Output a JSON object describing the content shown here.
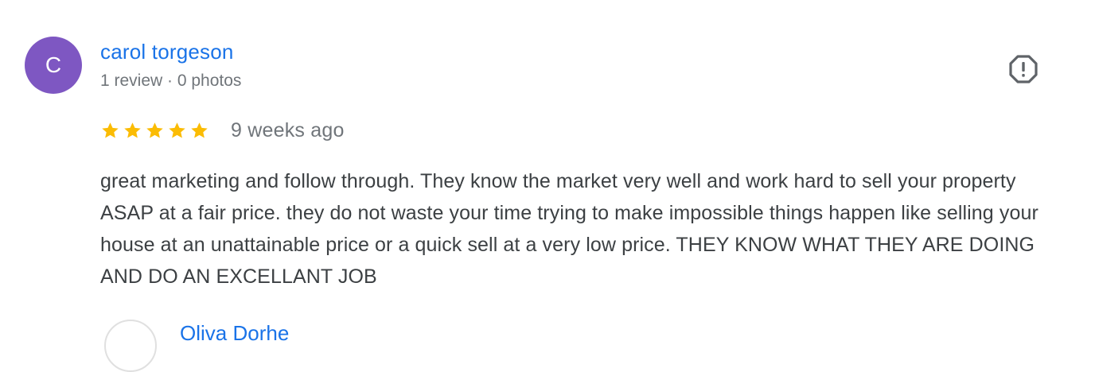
{
  "review": {
    "avatar_letter": "C",
    "avatar_color": "#7e57c2",
    "author": "carol torgeson",
    "meta": "1 review · 0 photos",
    "rating": 5,
    "rating_max": 5,
    "time": "9 weeks ago",
    "text": "great marketing and follow through. They know the market very well and work hard to sell your property ASAP at a fair price. they do not waste your time trying to make impossible things happen like selling your house at an unattainable price or a quick sell at a very low price. THEY KNOW WHAT THEY ARE DOING AND DO AN EXCELLANT JOB",
    "flag_icon": "report-flag-icon"
  },
  "next_review": {
    "author": "Oliva Dorhe"
  },
  "colors": {
    "link": "#1a73e8",
    "star": "#fbbc04",
    "text": "#3c4043",
    "secondary": "#70757a"
  }
}
